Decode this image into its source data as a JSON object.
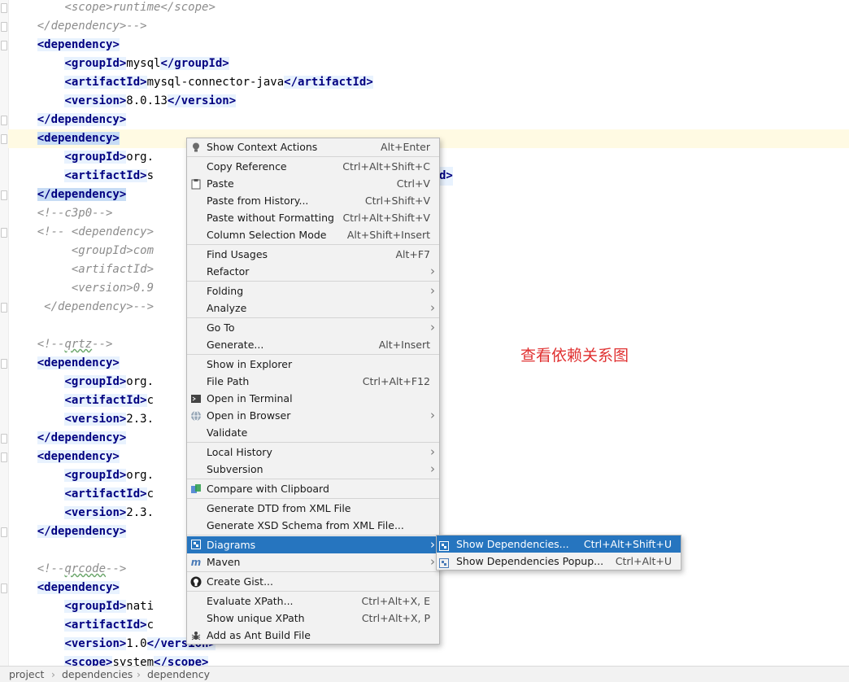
{
  "editor": {
    "lines": [
      {
        "indent": "        ",
        "parts": [
          {
            "t": "<scope>runtime</scope>",
            "k": "comment"
          }
        ]
      },
      {
        "indent": "    ",
        "parts": [
          {
            "t": "</dependency>-->",
            "k": "comment"
          }
        ]
      },
      {
        "indent": "    ",
        "parts": [
          {
            "t": "<",
            "k": "tag"
          },
          {
            "t": "dependency",
            "k": "tag"
          },
          {
            "t": ">",
            "k": "tag"
          }
        ]
      },
      {
        "indent": "        ",
        "parts": [
          {
            "t": "<groupId>",
            "k": "tag"
          },
          {
            "t": "mysql",
            "k": "text"
          },
          {
            "t": "</groupId>",
            "k": "tag"
          }
        ]
      },
      {
        "indent": "        ",
        "parts": [
          {
            "t": "<artifactId>",
            "k": "tag"
          },
          {
            "t": "mysql-connector-java",
            "k": "text"
          },
          {
            "t": "</artifactId>",
            "k": "tag"
          }
        ]
      },
      {
        "indent": "        ",
        "parts": [
          {
            "t": "<version>",
            "k": "tag"
          },
          {
            "t": "8.0.13",
            "k": "text"
          },
          {
            "t": "</version>",
            "k": "tag"
          }
        ]
      },
      {
        "indent": "    ",
        "parts": [
          {
            "t": "</dependency>",
            "k": "tag"
          }
        ]
      },
      {
        "indent": "    ",
        "parts": [
          {
            "t": "<dependency>",
            "k": "tagsel"
          }
        ],
        "current": true
      },
      {
        "indent": "        ",
        "parts": [
          {
            "t": "<groupId>",
            "k": "tag"
          },
          {
            "t": "org.",
            "k": "text"
          }
        ]
      },
      {
        "indent": "        ",
        "parts": [
          {
            "t": "<artifactId>",
            "k": "tag"
          },
          {
            "t": "s",
            "k": "text"
          }
        ],
        "tail": "d>"
      },
      {
        "indent": "    ",
        "parts": [
          {
            "t": "</dependency>",
            "k": "tagsel"
          }
        ]
      },
      {
        "indent": "    ",
        "parts": [
          {
            "t": "<!--c3p0-->",
            "k": "comment"
          }
        ]
      },
      {
        "indent": "    ",
        "parts": [
          {
            "t": "<!-- <dependency>",
            "k": "comment"
          }
        ]
      },
      {
        "indent": "         ",
        "parts": [
          {
            "t": "<groupId>com",
            "k": "comment"
          }
        ]
      },
      {
        "indent": "         ",
        "parts": [
          {
            "t": "<artifactId>",
            "k": "comment"
          }
        ]
      },
      {
        "indent": "         ",
        "parts": [
          {
            "t": "<version>0.9",
            "k": "comment"
          }
        ]
      },
      {
        "indent": "     ",
        "parts": [
          {
            "t": "</dependency>-->",
            "k": "comment"
          }
        ]
      },
      {
        "indent": "",
        "parts": []
      },
      {
        "indent": "    ",
        "parts": [
          {
            "t": "<!--",
            "k": "comment"
          },
          {
            "t": "qrtz",
            "k": "commentsq"
          },
          {
            "t": "-->",
            "k": "comment"
          }
        ]
      },
      {
        "indent": "    ",
        "parts": [
          {
            "t": "<dependency>",
            "k": "tag"
          }
        ]
      },
      {
        "indent": "        ",
        "parts": [
          {
            "t": "<groupId>",
            "k": "tag"
          },
          {
            "t": "org.",
            "k": "text"
          }
        ]
      },
      {
        "indent": "        ",
        "parts": [
          {
            "t": "<artifactId>",
            "k": "tag"
          },
          {
            "t": "c",
            "k": "text"
          }
        ]
      },
      {
        "indent": "        ",
        "parts": [
          {
            "t": "<version>",
            "k": "tag"
          },
          {
            "t": "2.3.",
            "k": "text"
          }
        ]
      },
      {
        "indent": "    ",
        "parts": [
          {
            "t": "</dependency>",
            "k": "tag"
          }
        ]
      },
      {
        "indent": "    ",
        "parts": [
          {
            "t": "<dependency>",
            "k": "tag"
          }
        ]
      },
      {
        "indent": "        ",
        "parts": [
          {
            "t": "<groupId>",
            "k": "tag"
          },
          {
            "t": "org.",
            "k": "text"
          }
        ]
      },
      {
        "indent": "        ",
        "parts": [
          {
            "t": "<artifactId>",
            "k": "tag"
          },
          {
            "t": "c",
            "k": "text"
          }
        ]
      },
      {
        "indent": "        ",
        "parts": [
          {
            "t": "<version>",
            "k": "tag"
          },
          {
            "t": "2.3.",
            "k": "text"
          }
        ]
      },
      {
        "indent": "    ",
        "parts": [
          {
            "t": "</dependency>",
            "k": "tag"
          }
        ]
      },
      {
        "indent": "",
        "parts": []
      },
      {
        "indent": "    ",
        "parts": [
          {
            "t": "<!--",
            "k": "comment"
          },
          {
            "t": "qrcode",
            "k": "commentsq"
          },
          {
            "t": "-->",
            "k": "comment"
          }
        ]
      },
      {
        "indent": "    ",
        "parts": [
          {
            "t": "<dependency>",
            "k": "tag"
          }
        ]
      },
      {
        "indent": "        ",
        "parts": [
          {
            "t": "<groupId>",
            "k": "tag"
          },
          {
            "t": "nati",
            "k": "text"
          }
        ]
      },
      {
        "indent": "        ",
        "parts": [
          {
            "t": "<artifactId>",
            "k": "tag"
          },
          {
            "t": "c",
            "k": "text"
          }
        ]
      },
      {
        "indent": "        ",
        "parts": [
          {
            "t": "<version>",
            "k": "tag"
          },
          {
            "t": "1.0",
            "k": "text"
          },
          {
            "t": "</version>",
            "k": "tag"
          }
        ]
      },
      {
        "indent": "        ",
        "parts": [
          {
            "t": "<scope>",
            "k": "tag"
          },
          {
            "t": "system",
            "k": "text"
          },
          {
            "t": "</scope>",
            "k": "tag"
          }
        ]
      }
    ]
  },
  "annotation": "查看依赖关系图",
  "context_menu": {
    "groups": [
      [
        {
          "icon": "bulb-icon",
          "glyph": "💡",
          "label": "Show Context Actions",
          "shortcut": "Alt+Enter"
        }
      ],
      [
        {
          "label": "Copy Reference",
          "shortcut": "Ctrl+Alt+Shift+C"
        },
        {
          "icon": "clipboard-icon",
          "glyph": "📋",
          "label": "Paste",
          "shortcut": "Ctrl+V"
        },
        {
          "label": "Paste from History...",
          "shortcut": "Ctrl+Shift+V"
        },
        {
          "label": "Paste without Formatting",
          "shortcut": "Ctrl+Alt+Shift+V"
        },
        {
          "label": "Column Selection Mode",
          "shortcut": "Alt+Shift+Insert"
        }
      ],
      [
        {
          "label": "Find Usages",
          "shortcut": "Alt+F7"
        },
        {
          "label": "Refactor",
          "submenu": true
        }
      ],
      [
        {
          "label": "Folding",
          "submenu": true
        },
        {
          "label": "Analyze",
          "submenu": true
        }
      ],
      [
        {
          "label": "Go To",
          "submenu": true
        },
        {
          "label": "Generate...",
          "shortcut": "Alt+Insert"
        }
      ],
      [
        {
          "label": "Show in Explorer"
        },
        {
          "label": "File Path",
          "shortcut": "Ctrl+Alt+F12"
        },
        {
          "icon": "terminal-icon",
          "glyph": "▣",
          "label": "Open in Terminal"
        },
        {
          "icon": "globe-icon",
          "glyph": "◍",
          "label": "Open in Browser",
          "submenu": true
        },
        {
          "label": "Validate"
        }
      ],
      [
        {
          "label": "Local History",
          "submenu": true
        },
        {
          "label": "Subversion",
          "submenu": true
        }
      ],
      [
        {
          "icon": "compare-icon",
          "glyph": "⇄",
          "label": "Compare with Clipboard"
        }
      ],
      [
        {
          "label": "Generate DTD from XML File"
        },
        {
          "label": "Generate XSD Schema from XML File..."
        }
      ],
      [
        {
          "icon": "diagram-icon",
          "glyph": "diag",
          "label": "Diagrams",
          "submenu": true,
          "highlighted": true
        },
        {
          "icon": "maven-icon",
          "glyph": "m",
          "label": "Maven",
          "submenu": true
        }
      ],
      [
        {
          "icon": "github-icon",
          "glyph": "●",
          "label": "Create Gist..."
        }
      ],
      [
        {
          "label": "Evaluate XPath...",
          "shortcut": "Ctrl+Alt+X, E"
        },
        {
          "label": "Show unique XPath",
          "shortcut": "Ctrl+Alt+X, P"
        },
        {
          "icon": "ant-icon",
          "glyph": "✱",
          "label": "Add as Ant Build File"
        }
      ]
    ]
  },
  "submenu": {
    "items": [
      {
        "label": "Show Dependencies...",
        "shortcut": "Ctrl+Alt+Shift+U",
        "highlighted": true
      },
      {
        "label": "Show Dependencies Popup...",
        "shortcut": "Ctrl+Alt+U"
      }
    ]
  },
  "breadcrumb": [
    "project",
    "dependencies",
    "dependency"
  ],
  "colors": {
    "accent": "#2675bf",
    "tag": "#000080",
    "comment": "#8c8c8c",
    "annotation": "#e03030"
  }
}
